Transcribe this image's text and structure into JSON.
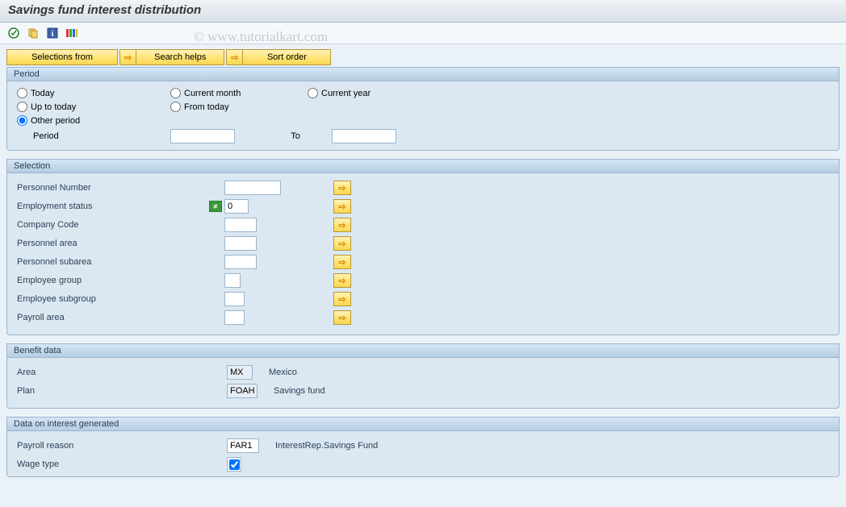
{
  "header": {
    "title": "Savings fund interest distribution"
  },
  "toolbar": {
    "icons": [
      "execute",
      "copy",
      "info",
      "layout"
    ]
  },
  "actionbar": {
    "selections_from": "Selections from",
    "search_helps": "Search helps",
    "sort_order": "Sort order"
  },
  "watermark": "© www.tutorialkart.com",
  "period": {
    "legend": "Period",
    "options": {
      "today": "Today",
      "current_month": "Current month",
      "current_year": "Current year",
      "up_to_today": "Up to today",
      "from_today": "From today",
      "other_period": "Other period"
    },
    "selected": "other_period",
    "period_label": "Period",
    "to_label": "To",
    "from_value": "",
    "to_value": ""
  },
  "selection": {
    "legend": "Selection",
    "rows": {
      "personnel_number": {
        "label": "Personnel Number",
        "value": ""
      },
      "employment_status": {
        "label": "Employment status",
        "value": "0",
        "eq": true
      },
      "company_code": {
        "label": "Company Code",
        "value": ""
      },
      "personnel_area": {
        "label": "Personnel area",
        "value": ""
      },
      "personnel_subarea": {
        "label": "Personnel subarea",
        "value": ""
      },
      "employee_group": {
        "label": "Employee group",
        "value": ""
      },
      "employee_subgroup": {
        "label": "Employee subgroup",
        "value": ""
      },
      "payroll_area": {
        "label": "Payroll area",
        "value": ""
      }
    }
  },
  "benefit": {
    "legend": "Benefit data",
    "area": {
      "label": "Area",
      "value": "MX",
      "desc": "Mexico"
    },
    "plan": {
      "label": "Plan",
      "value": "FOAH",
      "desc": "Savings fund"
    }
  },
  "interest": {
    "legend": "Data on interest generated",
    "payroll_reason": {
      "label": "Payroll reason",
      "value": "FAR1",
      "desc": "InterestRep.Savings Fund"
    },
    "wage_type": {
      "label": "Wage type",
      "checked": true
    }
  }
}
